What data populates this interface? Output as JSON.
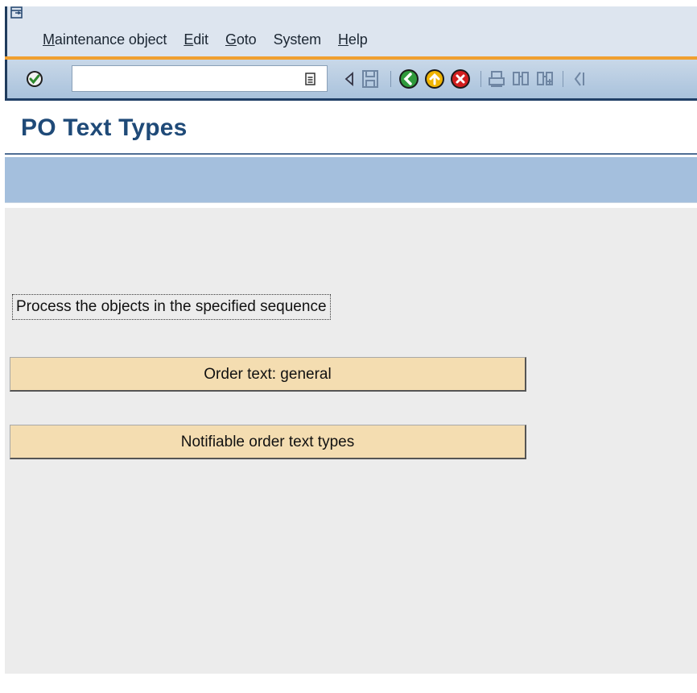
{
  "menubar": {
    "items": [
      {
        "underline": "M",
        "rest": "aintenance object"
      },
      {
        "underline": "E",
        "rest": "dit"
      },
      {
        "underline": "G",
        "rest": "oto"
      },
      {
        "underline": "",
        "rest": "System"
      },
      {
        "underline": "H",
        "rest": "elp"
      }
    ]
  },
  "toolbar": {
    "command_field_value": "",
    "icons": [
      "enter-icon",
      "history-icon",
      "back-arrow-icon",
      "save-icon",
      "back-icon",
      "exit-icon",
      "cancel-icon",
      "print-icon",
      "find-icon",
      "find-next-icon",
      "first-page-icon"
    ]
  },
  "page": {
    "title": "PO Text Types"
  },
  "content": {
    "instruction": "Process the objects in the specified sequence",
    "buttons": [
      "Order text: general",
      "Notifiable order text types"
    ]
  },
  "colors": {
    "menubar_bg": "#dde5ef",
    "accent_orange": "#f0a030",
    "toolbar_bg": "#b7cce3",
    "title_color": "#1f4a78",
    "button_bg": "#f4ddb1",
    "content_bg": "#ececec"
  }
}
